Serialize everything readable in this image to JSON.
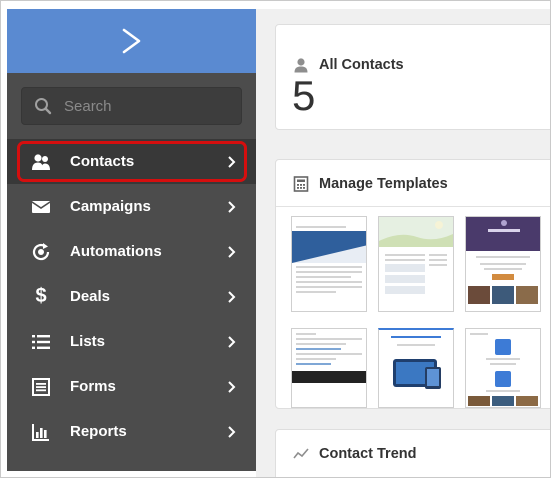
{
  "sidebar": {
    "search_placeholder": "Search",
    "items": [
      {
        "label": "Contacts",
        "icon": "contacts-icon",
        "active": true
      },
      {
        "label": "Campaigns",
        "icon": "envelope-icon"
      },
      {
        "label": "Automations",
        "icon": "automations-icon"
      },
      {
        "label": "Deals",
        "icon": "dollar-icon"
      },
      {
        "label": "Lists",
        "icon": "list-icon"
      },
      {
        "label": "Forms",
        "icon": "form-icon"
      },
      {
        "label": "Reports",
        "icon": "bar-chart-icon"
      }
    ]
  },
  "main": {
    "all_contacts": {
      "title": "All Contacts",
      "count": "5"
    },
    "templates": {
      "title": "Manage Templates"
    },
    "trend": {
      "title": "Contact Trend"
    }
  },
  "colors": {
    "brand": "#5a8ad1",
    "sidebar_bg": "#4c4c4c",
    "highlight": "#d50e0e",
    "template_blue": "#2f5f9c",
    "template_purple": "#4a3a6b"
  }
}
